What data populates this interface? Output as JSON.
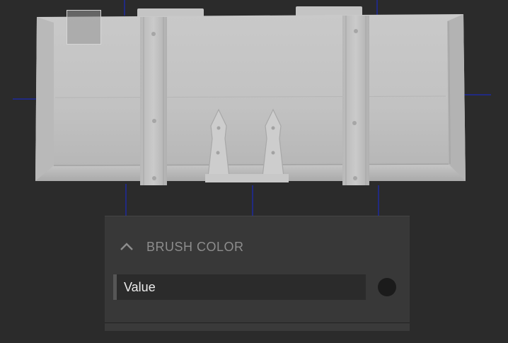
{
  "viewport": {
    "background": "#2b2b2b",
    "gizmo_color": "#1e2a9e",
    "model_color": "#bdbdbd"
  },
  "brush_panel": {
    "section_title": "BRUSH COLOR",
    "collapse_icon": "chevron-up-icon",
    "value_label": "Value",
    "color_value": "#1b1b1b"
  }
}
